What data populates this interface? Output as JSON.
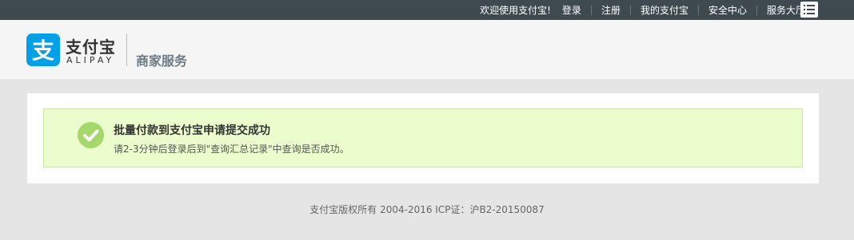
{
  "topbar": {
    "welcome": "欢迎使用支付宝!",
    "login": "登录",
    "register": "注册",
    "my_alipay": "我的支付宝",
    "security_center": "安全中心",
    "service_hall": "服务大厅",
    "menu_icon": "list-icon",
    "caret_icon": "caret-down-icon"
  },
  "header": {
    "logo_cn": "支付宝",
    "logo_en": "ALIPAY",
    "logo_icon": "alipay-logo-icon",
    "section_title": "商家服务"
  },
  "notice": {
    "icon": "check-circle-icon",
    "title": "批量付款到支付宝申请提交成功",
    "description": "请2-3分钟后登录后到\"查询汇总记录\"中查询是否成功。"
  },
  "footer": {
    "copyright": "支付宝版权所有 2004-2016 ICP证：沪B2-20150087"
  },
  "colors": {
    "topbar_bg": "#3f4a50",
    "brand_blue": "#00a0e9",
    "success_green": "#a5d86a",
    "notice_bg": "#ebfdcd"
  }
}
